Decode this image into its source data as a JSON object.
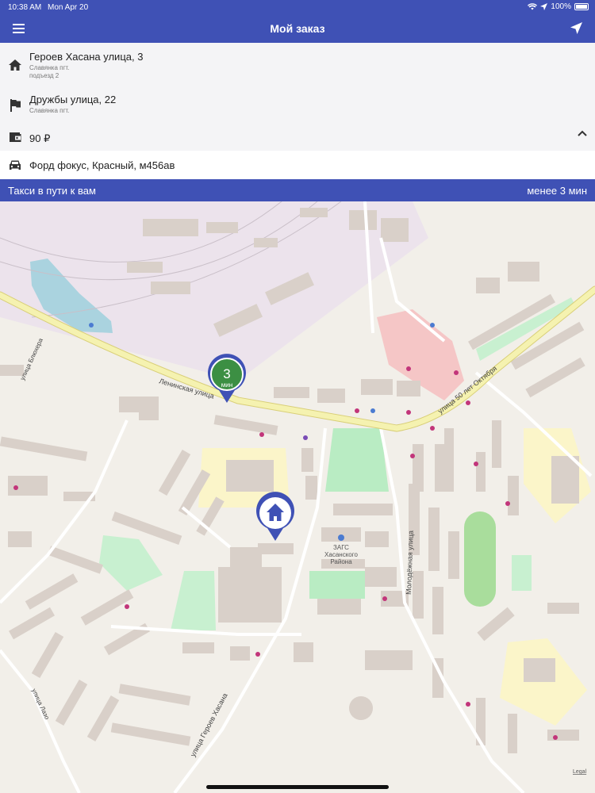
{
  "status_bar": {
    "time": "10:38 AM",
    "date": "Mon Apr 20",
    "battery": "100%"
  },
  "header": {
    "title": "Мой заказ",
    "menu_icon": "menu-icon",
    "locate_icon": "navigation-arrow-icon"
  },
  "order": {
    "pickup": {
      "street": "Героев Хасана улица, 3",
      "locality": "Славянка пгт.",
      "entrance": "подъезд 2",
      "icon": "home-icon"
    },
    "destination": {
      "street": "Дружбы улица, 22",
      "locality": "Славянка пгт.",
      "icon": "flag-icon"
    },
    "price": {
      "amount": "90 ₽",
      "icon": "wallet-icon"
    },
    "vehicle": {
      "description": "Форд фокус, Красный, м456ав",
      "icon": "car-icon"
    }
  },
  "status_banner": {
    "text": "Такси в пути к вам",
    "eta": "менее 3 мин"
  },
  "map": {
    "taxi_marker": {
      "value": "3",
      "unit": "мин"
    },
    "streets": [
      "улица Блюхера",
      "Ленинская улица",
      "улица 50 лет Октября",
      "Молодёжная улица",
      "улица Героев Хасана",
      "улица Лазо"
    ],
    "place_label": [
      "ЗАГС",
      "Хасанского",
      "Района"
    ],
    "legal": "Legal"
  },
  "colors": {
    "primary": "#3f51b5",
    "taxi_marker": "#3c8f43",
    "road": "#f5f2b0"
  }
}
